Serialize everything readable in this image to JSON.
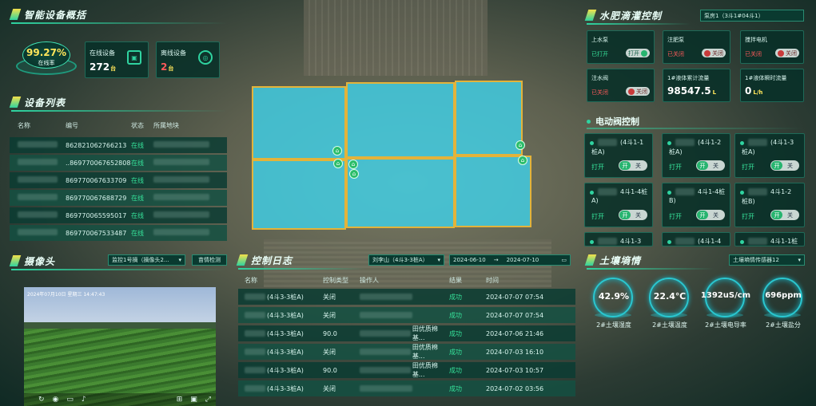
{
  "device_overview": {
    "title": "智能设备概括",
    "rate": "99.27%",
    "rate_label": "在线率",
    "online_label": "在线设备",
    "online_value": "272",
    "online_unit": "台",
    "offline_label": "离线设备",
    "offline_value": "2",
    "offline_unit": "台"
  },
  "device_list": {
    "title": "设备列表",
    "headers": [
      "名称",
      "编号",
      "状态",
      "所属地块"
    ],
    "rows": [
      {
        "id": "862821062766213",
        "status": "在线"
      },
      {
        "id": "..869770067652808",
        "status": "在线"
      },
      {
        "id": "869770067633709",
        "status": "在线"
      },
      {
        "id": "869770067688729",
        "status": "在线"
      },
      {
        "id": "869770065595017",
        "status": "在线"
      },
      {
        "id": "869770067533487",
        "status": "在线"
      }
    ]
  },
  "camera": {
    "title": "摄像头",
    "select": "监控1号摘（摘像头2...",
    "button": "苗情检测",
    "timestamp": "2024年07月10日 星期三 14:47:43"
  },
  "control_log": {
    "title": "控制日志",
    "filter": "刘李山（4斗3-3桩A）",
    "date_start": "2024-06-10",
    "date_sep": "→",
    "date_end": "2024-07-10",
    "headers": [
      "名称",
      "控制类型",
      "操作人",
      "结果",
      "时间"
    ],
    "rows": [
      {
        "name": "(4斗3-3桩A)",
        "type": "关闭",
        "op": "",
        "result": "成功",
        "time": "2024-07-07 07:54"
      },
      {
        "name": "(4斗3-3桩A)",
        "type": "关闭",
        "op": "",
        "result": "成功",
        "time": "2024-07-07 07:54"
      },
      {
        "name": "(4斗3-3桩A)",
        "type": "90.0",
        "op": "田优质棉基...",
        "result": "成功",
        "time": "2024-07-06 21:46"
      },
      {
        "name": "(4斗3-3桩A)",
        "type": "关闭",
        "op": "田优质棉基...",
        "result": "成功",
        "time": "2024-07-03 16:10"
      },
      {
        "name": "(4斗3-3桩A)",
        "type": "90.0",
        "op": "田优质棉基...",
        "result": "成功",
        "time": "2024-07-03 10:57"
      },
      {
        "name": "(4斗3-3桩A)",
        "type": "关闭",
        "op": "",
        "result": "成功",
        "time": "2024-07-02 03:56"
      }
    ]
  },
  "irrigation": {
    "title": "水肥滴灌控制",
    "select": "泵房1（3斗1#04斗1）",
    "cards": [
      {
        "label": "上水泵",
        "status": "已打开",
        "toggle": "打开",
        "on": true
      },
      {
        "label": "注肥泵",
        "status": "已关闭",
        "toggle": "关闭",
        "on": false
      },
      {
        "label": "搅拌电机",
        "status": "已关闭",
        "toggle": "关闭",
        "on": false
      },
      {
        "label": "注水阀",
        "status": "已关闭",
        "toggle": "关闭",
        "on": false
      }
    ],
    "flow1_label": "1#液体累计流量",
    "flow1_value": "98547.5",
    "flow1_unit": "L",
    "flow2_label": "1#液体瞬时流量",
    "flow2_value": "0",
    "flow2_unit": "L/h"
  },
  "valve": {
    "title": "电动阀控制",
    "cards": [
      {
        "name": "(4斗1-1",
        "sub": "桩A)",
        "state": "打开",
        "toggle_on": "开",
        "toggle_off": "关"
      },
      {
        "name": "(4斗1-2",
        "sub": "桩A)",
        "state": "打开",
        "toggle_on": "开",
        "toggle_off": "关"
      },
      {
        "name": "(4斗1-3",
        "sub": "桩A)",
        "state": "打开",
        "toggle_on": "开",
        "toggle_off": "关"
      },
      {
        "name": "4斗1-4桩",
        "sub": "A)",
        "state": "打开",
        "toggle_on": "开",
        "toggle_off": "关"
      },
      {
        "name": "4斗1-4桩",
        "sub": "B)",
        "state": "打开",
        "toggle_on": "开",
        "toggle_off": "关"
      },
      {
        "name": "4斗1-2",
        "sub": "桩B)",
        "state": "打开",
        "toggle_on": "开",
        "toggle_off": "关"
      },
      {
        "name": "4斗1-3",
        "sub": "",
        "state": "",
        "toggle_on": "",
        "toggle_off": ""
      },
      {
        "name": "(4斗1-4",
        "sub": "",
        "state": "",
        "toggle_on": "",
        "toggle_off": ""
      },
      {
        "name": "4斗1-1桩",
        "sub": "",
        "state": "",
        "toggle_on": "",
        "toggle_off": ""
      }
    ]
  },
  "soil": {
    "title": "土壤墒情",
    "select": "土壤墒情传感器12",
    "gauges": [
      {
        "value": "42.9%",
        "label": "2#土壤湿度"
      },
      {
        "value": "22.4℃",
        "label": "2#土壤温度"
      },
      {
        "value": "1392uS/cm",
        "label": "2#土壤电导率"
      },
      {
        "value": "696ppm",
        "label": "2#土壤盐分"
      }
    ]
  }
}
